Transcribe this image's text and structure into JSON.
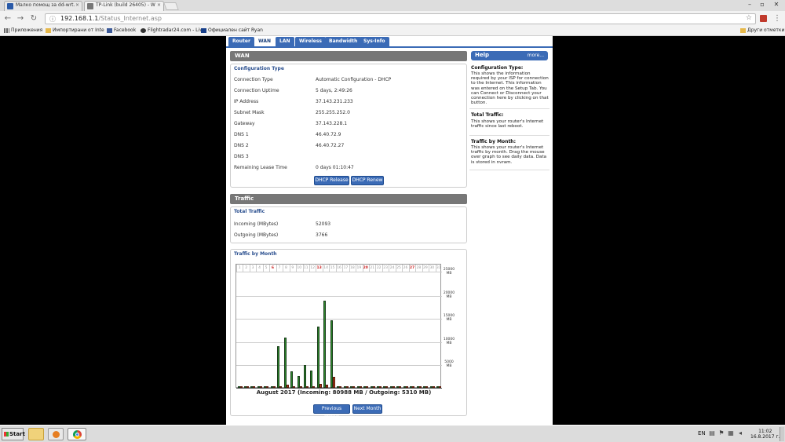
{
  "browser": {
    "tabs": [
      {
        "title": "Малко помощ за dd-wrt.",
        "active": false,
        "favicon_color": "#2a5aa8"
      },
      {
        "title": "TP-Link (build 26405) - W",
        "active": true,
        "favicon_color": "#777777"
      }
    ],
    "url_host": "192.168.1.1",
    "url_path": "/Status_Internet.asp",
    "bookmarks": [
      {
        "label": "Приложения"
      },
      {
        "label": "Импортирани от Inte"
      },
      {
        "label": "Facebook"
      },
      {
        "label": "Flightradar24.com - Liv"
      },
      {
        "label": "Официален сайт Ryan"
      }
    ],
    "other_bookmarks": "Други отметки"
  },
  "nav": {
    "tabs": [
      {
        "label": "Router",
        "selected": false
      },
      {
        "label": "WAN",
        "selected": true
      },
      {
        "label": "LAN",
        "selected": false
      },
      {
        "label": "Wireless",
        "selected": false
      },
      {
        "label": "Bandwidth",
        "selected": false
      },
      {
        "label": "Sys-Info",
        "selected": false
      }
    ]
  },
  "wan": {
    "header": "WAN",
    "legend": "Configuration Type",
    "rows": [
      {
        "label": "Connection Type",
        "value": "Automatic Configuration - DHCP"
      },
      {
        "label": "Connection Uptime",
        "value": "5 days, 2:49:26"
      },
      {
        "label": "IP Address",
        "value": "37.143.231.233"
      },
      {
        "label": "Subnet Mask",
        "value": "255.255.252.0"
      },
      {
        "label": "Gateway",
        "value": "37.143.228.1"
      },
      {
        "label": "DNS 1",
        "value": "46.40.72.9"
      },
      {
        "label": "DNS 2",
        "value": "46.40.72.27"
      },
      {
        "label": "DNS 3",
        "value": ""
      },
      {
        "label": "Remaining Lease Time",
        "value": "0 days 01:10:47"
      }
    ],
    "dhcp_release": "DHCP Release",
    "dhcp_renew": "DHCP Renew"
  },
  "traffic": {
    "header": "Traffic",
    "total_legend": "Total Traffic",
    "incoming_label": "Incoming (MBytes)",
    "incoming_value": "52093",
    "outgoing_label": "Outgoing (MBytes)",
    "outgoing_value": "3766",
    "month_legend": "Traffic by Month",
    "caption": "August 2017 (Incoming: 80988 MB / Outgoing: 5310 MB)",
    "prev_month": "Previous Month",
    "next_month": "Next Month"
  },
  "help": {
    "title": "Help",
    "more": "more...",
    "sections": [
      {
        "heading": "Configuration Type:",
        "text": "This shows the information required by your ISP for connection to the Internet. This information was entered on the Setup Tab. You can Connect or Disconnect your connection here by clicking on that button."
      },
      {
        "heading": "Total Traffic:",
        "text": "This shows your router's Internet traffic since last reboot."
      },
      {
        "heading": "Traffic by Month:",
        "text": "This shows your router's Internet traffic by month. Drag the mouse over graph to see daily data. Data is stored in nvram."
      }
    ]
  },
  "chart_data": {
    "type": "bar",
    "title": "August 2017 (Incoming: 80988 MB / Outgoing: 5310 MB)",
    "categories": [
      "1",
      "2",
      "3",
      "4",
      "5",
      "6",
      "7",
      "8",
      "9",
      "10",
      "11",
      "12",
      "13",
      "14",
      "15",
      "16",
      "17",
      "18",
      "19",
      "20",
      "21",
      "22",
      "23",
      "24",
      "25",
      "26",
      "27",
      "28",
      "29",
      "30",
      "31"
    ],
    "highlighted_days": [
      "6",
      "13",
      "20",
      "27"
    ],
    "highlight_color": "#cc2222",
    "y_tick_labels": [
      "25000 MB",
      "20000 MB",
      "15000 MB",
      "10000 MB",
      "5000 MB"
    ],
    "ylim": [
      0,
      25000
    ],
    "series": [
      {
        "name": "Incoming",
        "color": "#2d8a2d",
        "values": [
          0,
          0,
          0,
          0,
          0,
          0,
          8900,
          10800,
          3500,
          2600,
          4900,
          3800,
          13200,
          18700,
          14500,
          0,
          0,
          0,
          0,
          0,
          0,
          0,
          0,
          0,
          0,
          0,
          0,
          0,
          0,
          0,
          0
        ]
      },
      {
        "name": "Outgoing",
        "color": "#c23b1a",
        "values": [
          0,
          0,
          0,
          0,
          0,
          0,
          400,
          600,
          200,
          150,
          300,
          250,
          900,
          700,
          2300,
          0,
          0,
          0,
          0,
          0,
          0,
          0,
          0,
          0,
          0,
          0,
          0,
          0,
          0,
          0,
          0
        ]
      }
    ]
  },
  "taskbar": {
    "start": "Start",
    "lang": "EN",
    "time": "11:02",
    "date": "16.8.2017 г."
  }
}
